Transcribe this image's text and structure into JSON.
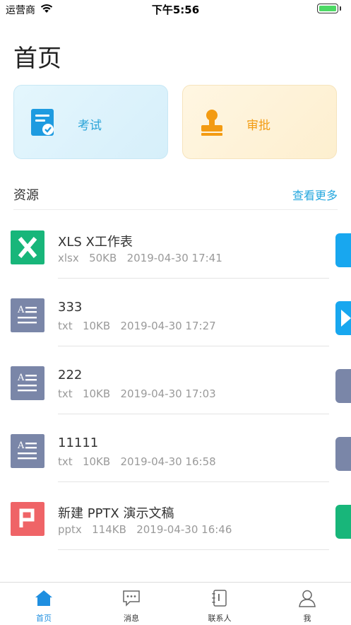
{
  "status_bar": {
    "carrier": "运营商",
    "time": "下午5:56"
  },
  "page_title": "首页",
  "cards": {
    "exam": {
      "label": "考试",
      "icon": "exam-doc-icon",
      "color": "#2aa4d8"
    },
    "approve": {
      "label": "审批",
      "icon": "stamp-icon",
      "color": "#f39b12"
    }
  },
  "resources": {
    "title": "资源",
    "more_label": "查看更多",
    "items": [
      {
        "name": "XLS X工作表",
        "type": "xlsx",
        "size": "50KB",
        "time": "2019-04-30 17:41",
        "icon": "excel-file-icon"
      },
      {
        "name": "333",
        "type": "txt",
        "size": "10KB",
        "time": "2019-04-30 17:27",
        "icon": "text-file-icon"
      },
      {
        "name": "222",
        "type": "txt",
        "size": "10KB",
        "time": "2019-04-30 17:03",
        "icon": "text-file-icon"
      },
      {
        "name": "11111",
        "type": "txt",
        "size": "10KB",
        "time": "2019-04-30 16:58",
        "icon": "text-file-icon"
      },
      {
        "name": "新建 PPTX 演示文稿",
        "type": "pptx",
        "size": "114KB",
        "time": "2019-04-30 16:46",
        "icon": "ppt-file-icon"
      }
    ]
  },
  "tabs": [
    {
      "label": "首页",
      "icon": "home-icon",
      "active": true
    },
    {
      "label": "消息",
      "icon": "message-icon",
      "active": false
    },
    {
      "label": "联系人",
      "icon": "contacts-icon",
      "active": false
    },
    {
      "label": "我",
      "icon": "person-icon",
      "active": false
    }
  ],
  "colors": {
    "accent": "#1f8fe0",
    "excel": "#18b67a",
    "text_file": "#7a86a8",
    "ppt": "#ef6467",
    "peek_blue": "#18a7ef"
  }
}
